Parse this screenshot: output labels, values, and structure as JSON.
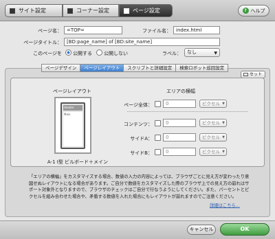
{
  "tabs_top": [
    "サイト設定",
    "コーナー設定",
    "ページ設定"
  ],
  "help_label": "ヘルプ",
  "form": {
    "page_name_label": "ページ名：",
    "page_name_value": "=TOP=",
    "file_name_label": "ファイル名：",
    "file_name_value": "index.html",
    "page_title_label": "ページタイトル：",
    "page_title_value": "[BD:page_name] of [BD:site_name]",
    "publish_label": "このページを",
    "publish_on": "公開する",
    "publish_off": "公開しない",
    "label_label": "ラベル：",
    "label_value": "なし"
  },
  "subtabs": [
    "ページデザイン",
    "ページレイアウト",
    "スクリプトと詳細設定",
    "検索ロボット巡回設定"
  ],
  "set_button": "セット",
  "layout": {
    "title": "ページレイアウト",
    "preview_header": "Header",
    "preview_main": "Main",
    "caption": "A-1 I型 ビルボード＋メイン"
  },
  "area_width": {
    "title": "エリアの横幅",
    "rows": [
      {
        "label": "ページ全体：",
        "value": "0",
        "unit": "ピクセル"
      },
      {
        "label": "コンテンツ：",
        "value": "0",
        "unit": "ピクセル"
      },
      {
        "label": "サイドA：",
        "value": "0",
        "unit": "ピクセル"
      },
      {
        "label": "サイドB：",
        "value": "0",
        "unit": "ピクセル"
      }
    ]
  },
  "note": "「エリアの横幅」をカスタマイズする場合、数値の入力の内容によっては、ブラウザごとに見え方が変わったり意図せぬレイアウトになる場合があります。ご自分で数値をカスタマイズした際のブラウザ上での見え方の崩れはサポート対象外となりますので、ブラウザのチェックはご自分で行なうようにしてください。また、パーセントとピクセルを組み合わせた場合や、矛盾する数値を入れた場合にもレイアウトが崩れますのでご注意ください。",
  "details_link": "詳細はこちら...",
  "buttons": {
    "cancel": "キャンセル",
    "ok": "OK"
  }
}
